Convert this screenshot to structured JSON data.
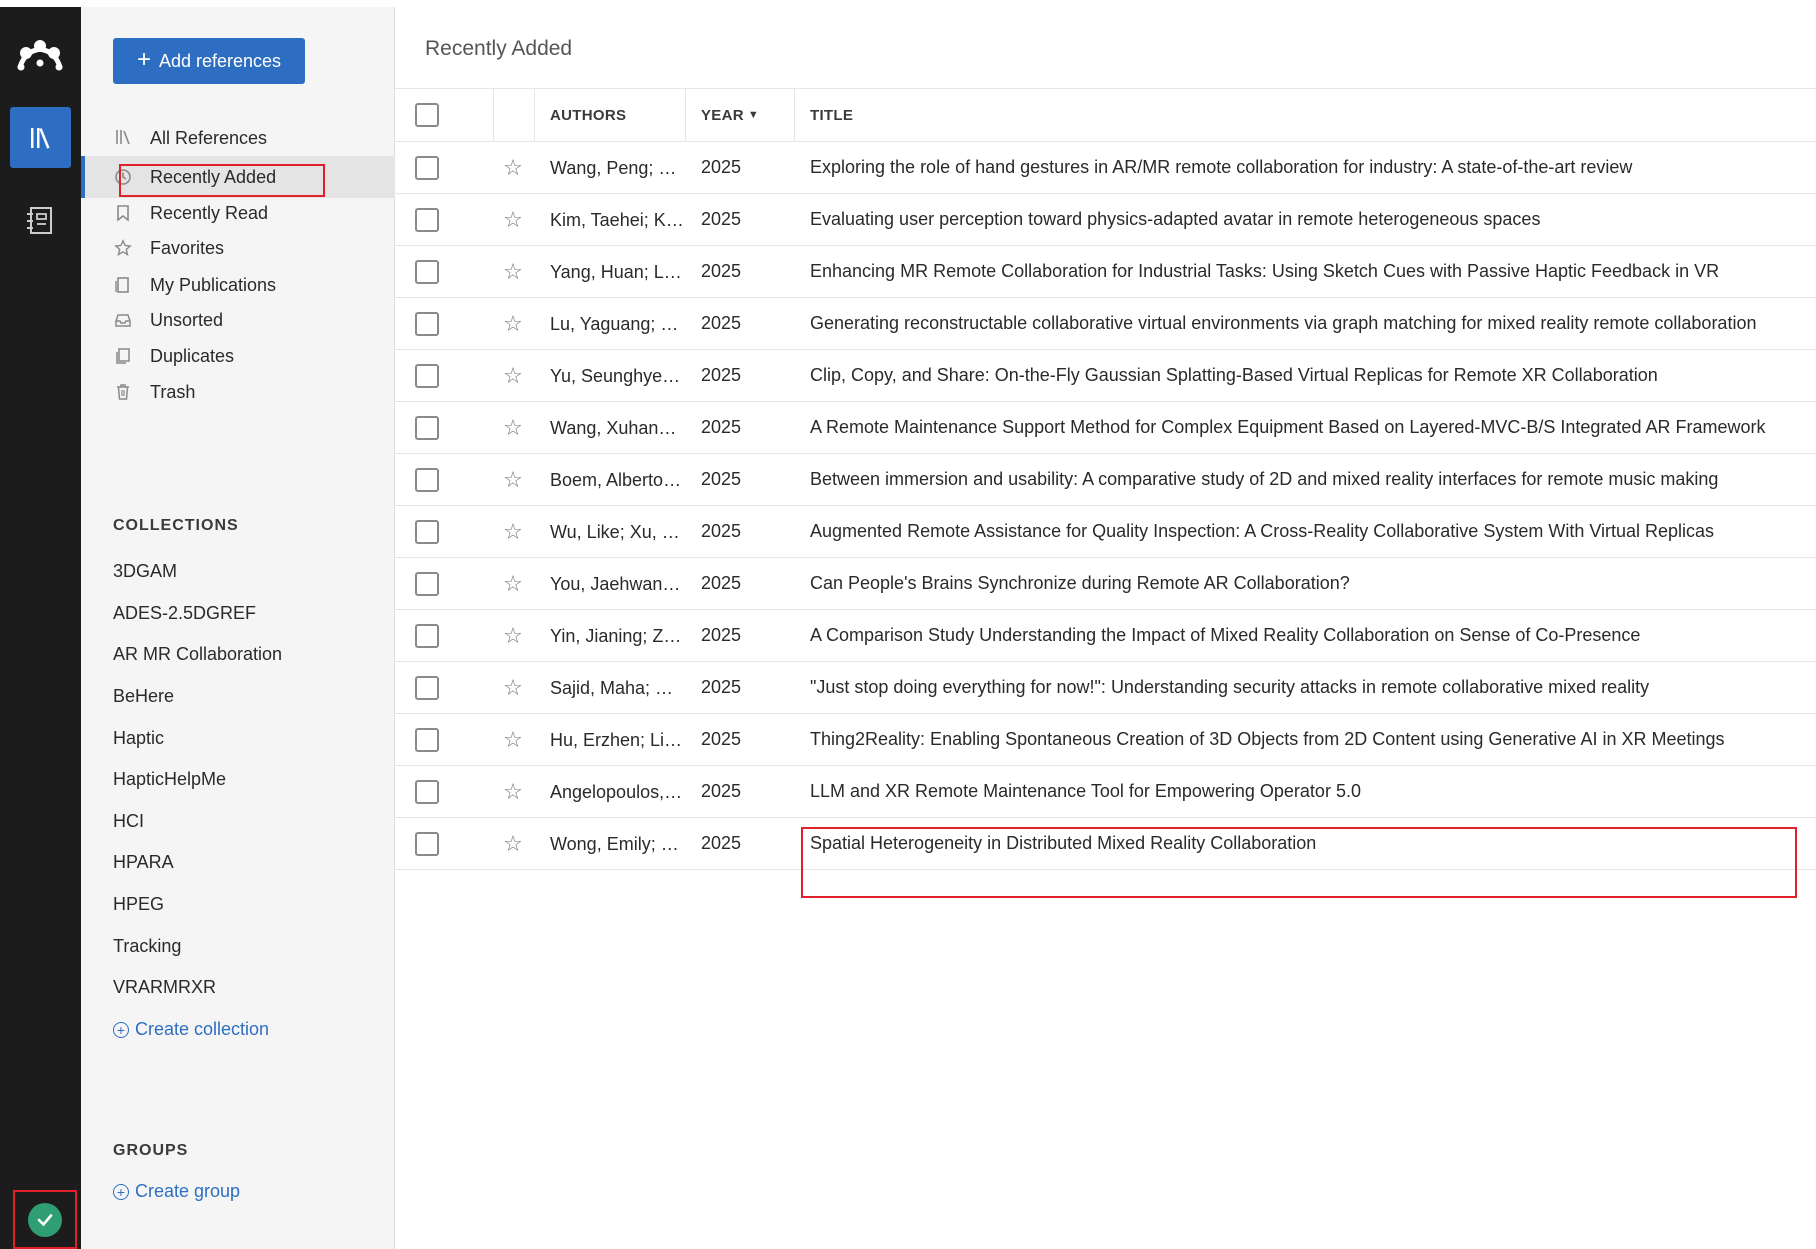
{
  "app": {
    "rail": {
      "logo_icon": "mendeley-logo-icon",
      "library_icon": "library-books-icon",
      "notebook_icon": "notebook-icon",
      "sync_icon": "sync-check-icon"
    },
    "colors": {
      "accent": "#2e6ec2",
      "rail": "#1c1c1c",
      "sync": "#2f9e73",
      "highlight": "#e0212b"
    }
  },
  "sidebar": {
    "add_button": "Add references",
    "nav": [
      {
        "label": "All References",
        "icon": "books-icon"
      },
      {
        "label": "Recently Added",
        "icon": "clock-icon",
        "active": true
      },
      {
        "label": "Recently Read",
        "icon": "bookmark-icon"
      },
      {
        "label": "Favorites",
        "icon": "star-icon"
      },
      {
        "label": "My Publications",
        "icon": "document-icon"
      },
      {
        "label": "Unsorted",
        "icon": "inbox-icon"
      },
      {
        "label": "Duplicates",
        "icon": "duplicate-icon"
      },
      {
        "label": "Trash",
        "icon": "trash-icon"
      }
    ],
    "collections_header": "COLLECTIONS",
    "collections": [
      "3DGAM",
      "ADES-2.5DGREF",
      "AR MR Collaboration",
      "BeHere",
      "Haptic",
      "HapticHelpMe",
      "HCI",
      "HPARA",
      "HPEG",
      "Tracking",
      "VRARMRXR"
    ],
    "create_collection": "Create collection",
    "groups_header": "GROUPS",
    "create_group": "Create group"
  },
  "main": {
    "title": "Recently Added",
    "columns": {
      "authors": "AUTHORS",
      "year": "YEAR",
      "title": "TITLE"
    },
    "rows": [
      {
        "authors": "Wang, Peng; …",
        "year": "2025",
        "title": "Exploring the role of hand gestures in AR/MR remote collaboration for industry: A state-of-the-art review"
      },
      {
        "authors": "Kim, Taehei; K…",
        "year": "2025",
        "title": "Evaluating user perception toward physics-adapted avatar in remote heterogeneous spaces"
      },
      {
        "authors": "Yang, Huan; L…",
        "year": "2025",
        "title": "Enhancing MR Remote Collaboration for Industrial Tasks: Using Sketch Cues with Passive Haptic Feedback in VR"
      },
      {
        "authors": "Lu, Yaguang; …",
        "year": "2025",
        "title": "Generating reconstructable collaborative virtual environments via graph matching for mixed reality remote collaboration"
      },
      {
        "authors": "Yu, Seunghye…",
        "year": "2025",
        "title": "Clip, Copy, and Share: On-the-Fly Gaussian Splatting-Based Virtual Replicas for Remote XR Collaboration"
      },
      {
        "authors": "Wang, Xuhan…",
        "year": "2025",
        "title": "A Remote Maintenance Support Method for Complex Equipment Based on Layered-MVC-B/S Integrated AR Framework"
      },
      {
        "authors": "Boem, Alberto…",
        "year": "2025",
        "title": "Between immersion and usability: A comparative study of 2D and mixed reality interfaces for remote music making"
      },
      {
        "authors": "Wu, Like; Xu, …",
        "year": "2025",
        "title": "Augmented Remote Assistance for Quality Inspection: A Cross-Reality Collaborative System With Virtual Replicas"
      },
      {
        "authors": "You, Jaehwan…",
        "year": "2025",
        "title": "Can People's Brains Synchronize during Remote AR Collaboration?"
      },
      {
        "authors": "Yin, Jianing; Z…",
        "year": "2025",
        "title": "A Comparison Study Understanding the Impact of Mixed Reality Collaboration on Sense of Co-Presence"
      },
      {
        "authors": "Sajid, Maha; …",
        "year": "2025",
        "title": "\"Just stop doing everything for now!\": Understanding security attacks in remote collaborative mixed reality"
      },
      {
        "authors": "Hu, Erzhen; Li…",
        "year": "2025",
        "title": "Thing2Reality: Enabling Spontaneous Creation of 3D Objects from 2D Content using Generative AI in XR Meetings"
      },
      {
        "authors": "Angelopoulos,…",
        "year": "2025",
        "title": "LLM and XR Remote Maintenance Tool for Empowering Operator 5.0"
      },
      {
        "authors": "Wong, Emily; …",
        "year": "2025",
        "title": "Spatial Heterogeneity in Distributed Mixed Reality Collaboration"
      }
    ]
  }
}
